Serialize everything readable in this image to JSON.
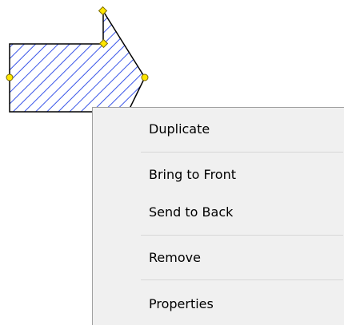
{
  "canvas": {
    "background": "#ffffff"
  },
  "shape": {
    "kind": "pentagon-arrow",
    "fill_pattern": "diagonal-hatch",
    "hatch_color": "#3a55e8",
    "outline_color": "#000000",
    "handle_color": "#ffe600",
    "handle_outline": "#7a6a00"
  },
  "context_menu": {
    "background": "#f0f0f0",
    "items": [
      {
        "label": "Duplicate"
      },
      {
        "label": "Bring to Front"
      },
      {
        "label": "Send to Back"
      },
      {
        "label": "Remove"
      },
      {
        "label": "Properties"
      }
    ]
  }
}
